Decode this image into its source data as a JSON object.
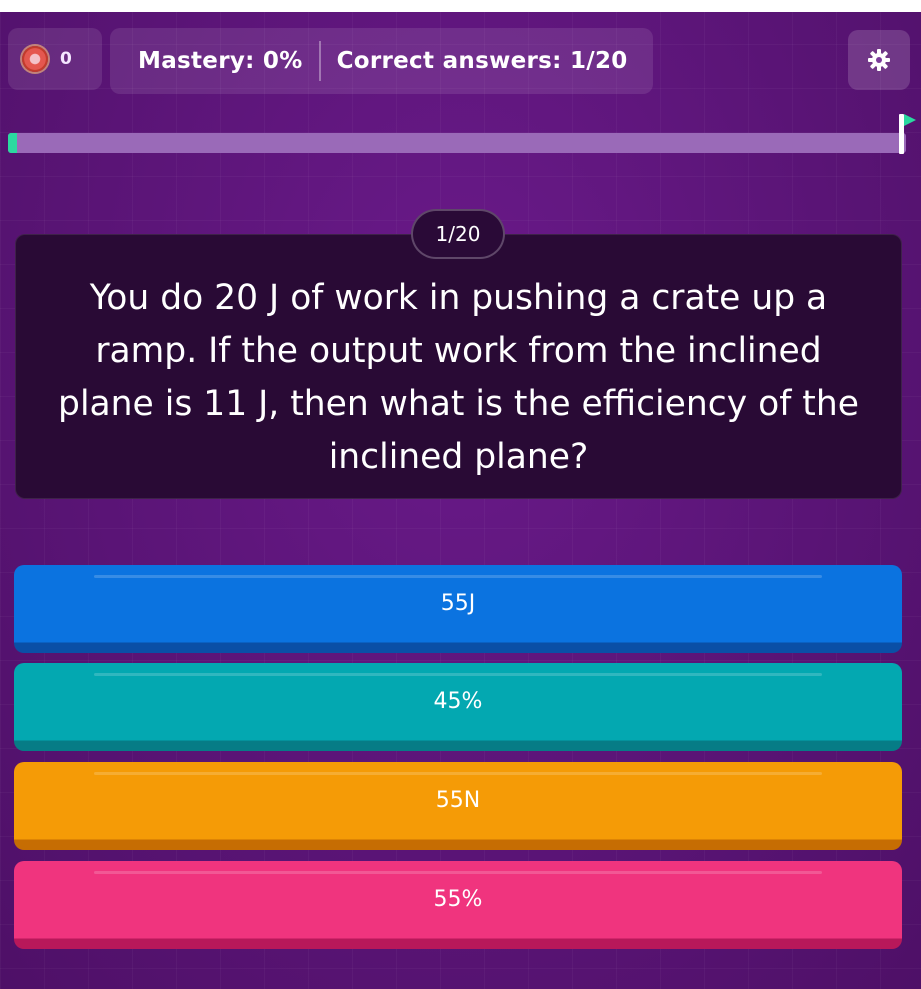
{
  "header": {
    "streak_count": "0",
    "mastery": "Mastery: 0%",
    "correct_answers": "Correct answers: 1/20",
    "icons": {
      "streak": "streak-icon",
      "settings": "gear-icon",
      "finish": "flag-icon"
    }
  },
  "progress": {
    "fraction": 0.01,
    "fill_color": "#2bd9a0",
    "track_color": "#9a6ab8"
  },
  "question": {
    "counter": "1/20",
    "text": "You do 20 J of work in pushing a crate up a ramp. If the output work from the inclined plane is 11 J, then what is the efficiency of the inclined plane?"
  },
  "options": [
    {
      "label": "55J",
      "color": "#0b73e0"
    },
    {
      "label": "45%",
      "color": "#03a8b1"
    },
    {
      "label": "55N",
      "color": "#f59b06"
    },
    {
      "label": "55%",
      "color": "#f0347e"
    }
  ]
}
